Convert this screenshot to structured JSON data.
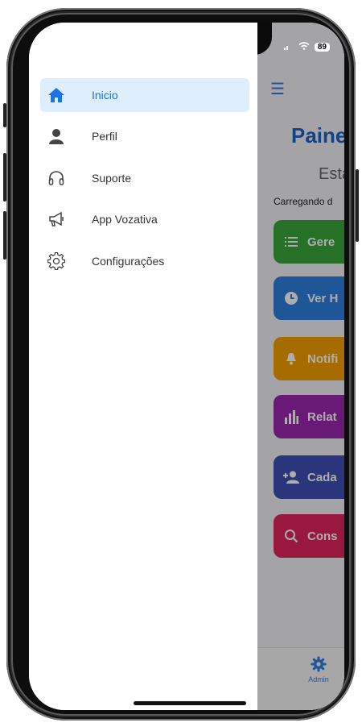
{
  "status": {
    "battery": "89"
  },
  "drawer": {
    "items": [
      {
        "label": "Inicio",
        "icon": "home-icon",
        "active": true
      },
      {
        "label": "Perfil",
        "icon": "person-icon",
        "active": false
      },
      {
        "label": "Suporte",
        "icon": "headphones-icon",
        "active": false
      },
      {
        "label": "App Vozativa",
        "icon": "megaphone-icon",
        "active": false
      },
      {
        "label": "Configurações",
        "icon": "gear-icon",
        "active": false
      }
    ]
  },
  "app": {
    "title": "Paine",
    "subtitle": "Esta",
    "loading_text": "Carregando d",
    "buttons": [
      {
        "label": "Gere",
        "color": "#3aa63a",
        "icon": "list-icon"
      },
      {
        "label": "Ver H",
        "color": "#2f7fe0",
        "icon": "clock-icon"
      },
      {
        "label": "Notifi",
        "color": "#f5a000",
        "icon": "bell-icon"
      },
      {
        "label": "Relat",
        "color": "#9b27b0",
        "icon": "bar-chart-icon"
      },
      {
        "label": "Cada",
        "color": "#3f4fb5",
        "icon": "add-user-icon"
      },
      {
        "label": "Cons",
        "color": "#e0245e",
        "icon": "search-icon"
      }
    ],
    "tabbar": {
      "admin_label": "Admin"
    }
  },
  "colors": {
    "accent": "#1a73e8",
    "active_bg": "#dfeefd"
  }
}
